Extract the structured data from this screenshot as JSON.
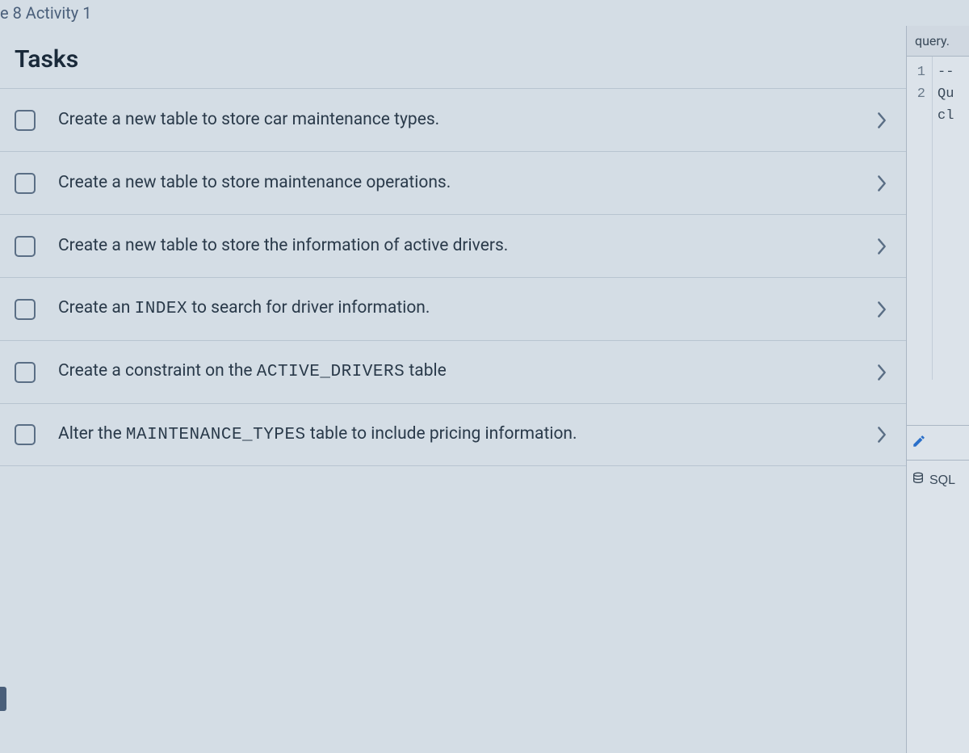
{
  "breadcrumb": "e 8 Activity 1",
  "tasks_heading": "Tasks",
  "tasks": [
    {
      "segments": [
        {
          "type": "text",
          "value": "Create a new table to store car maintenance types."
        }
      ]
    },
    {
      "segments": [
        {
          "type": "text",
          "value": "Create a new table to store maintenance operations."
        }
      ]
    },
    {
      "segments": [
        {
          "type": "text",
          "value": "Create a new table to store the information of active drivers."
        }
      ]
    },
    {
      "segments": [
        {
          "type": "text",
          "value": "Create an "
        },
        {
          "type": "code",
          "value": "INDEX"
        },
        {
          "type": "text",
          "value": " to search for driver information."
        }
      ]
    },
    {
      "segments": [
        {
          "type": "text",
          "value": "Create a constraint on the "
        },
        {
          "type": "code",
          "value": "ACTIVE_DRIVERS"
        },
        {
          "type": "text",
          "value": " table"
        }
      ]
    },
    {
      "segments": [
        {
          "type": "text",
          "value": "Alter the "
        },
        {
          "type": "code",
          "value": "MAINTENANCE_TYPES"
        },
        {
          "type": "text",
          "value": " table to include pricing information."
        }
      ]
    }
  ],
  "editor": {
    "tab_label": "query.",
    "gutter_lines": [
      "1",
      "2"
    ],
    "code_lines": [
      "--",
      "Qu",
      "cl",
      ""
    ],
    "sql_label": "SQL"
  }
}
